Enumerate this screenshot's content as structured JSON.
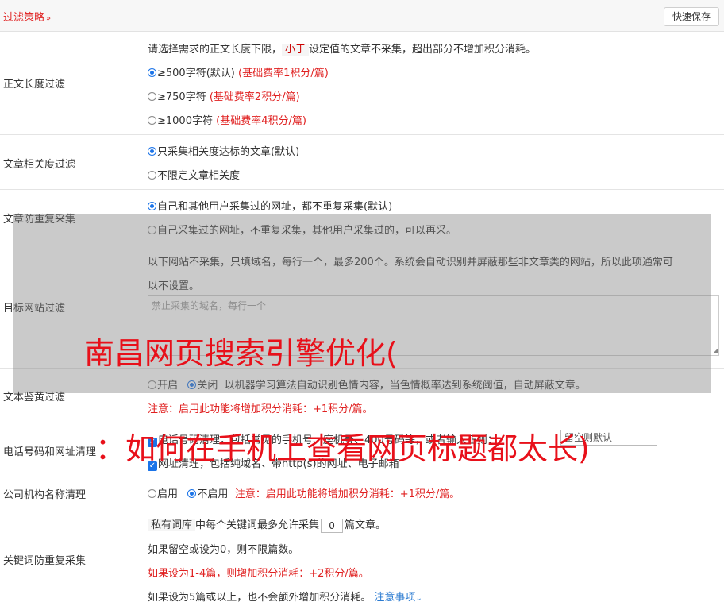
{
  "header": {
    "title": "过滤策略",
    "chevron": "»",
    "save_label": "快速保存"
  },
  "length_filter": {
    "label": "正文长度过滤",
    "desc_pre": "请选择需求的正文长度下限，",
    "desc_hl": "小于",
    "desc_post": "设定值的文章不采集，超出部分不增加积分消耗。",
    "options": [
      {
        "text": "≥500字符(默认)",
        "note": "(基础费率1积分/篇)",
        "selected": true
      },
      {
        "text": "≥750字符",
        "note": "(基础费率2积分/篇)",
        "selected": false
      },
      {
        "text": "≥1000字符",
        "note": "(基础费率4积分/篇)",
        "selected": false
      }
    ]
  },
  "relevance": {
    "label": "文章相关度过滤",
    "options": [
      {
        "text": "只采集相关度达标的文章(默认)",
        "selected": true
      },
      {
        "text": "不限定文章相关度",
        "selected": false
      }
    ]
  },
  "dedup": {
    "label": "文章防重复采集",
    "options": [
      {
        "text": "自己和其他用户采集过的网址，都不重复采集(默认)",
        "selected": true
      },
      {
        "text": "自己采集过的网址，不重复采集，其他用户采集过的，可以再采。",
        "selected": false
      }
    ]
  },
  "site_filter": {
    "label": "目标网站过滤",
    "desc1": "以下网站不采集，只填域名，每行一个，最多200个。系统会自动识别并屏蔽那些非文章类的网站，所以此项通常可",
    "desc2": "以不设置。",
    "placeholder": "禁止采集的域名，每行一个"
  },
  "porn_filter": {
    "label": "文本鉴黄过滤",
    "opt_on": "开启",
    "opt_off": "关闭",
    "desc": "以机器学习算法自动识别色情内容，当色情概率达到系统阈值，自动屏蔽文章。",
    "note": "注意：启用此功能将增加积分消耗：+1积分/篇。"
  },
  "phone_clean": {
    "label": "电话号码和网址清理",
    "line1": "电话号码清理，包括常见的手机号、座机号、400号码等，或者输入正则：",
    "regex_value": "留空则默认",
    "line2": "网址清理，包括纯域名、带http(s)的网址、电子邮箱"
  },
  "org_clean": {
    "label": "公司机构名称清理",
    "opt_on": "启用",
    "opt_off": "不启用",
    "note": "注意：启用此功能将增加积分消耗：+1积分/篇。"
  },
  "keyword_dedup": {
    "label": "关键词防重复采集",
    "hl": "私有词库",
    "line1_a": "中每个关键词最多允许采集",
    "value": "0",
    "line1_b": "篇文章。",
    "line2": "如果留空或设为0，则不限篇数。",
    "line3": "如果设为1-4篇，则增加积分消耗：+2积分/篇。",
    "line4": "如果设为5篇或以上，也不会额外增加积分消耗。",
    "link": "注意事项"
  },
  "watermark": {
    "line1": "南昌网页搜索引擎优化(",
    "line2": "：如何在手机上查看网页标题都太长)"
  },
  "colors": {
    "accent_red": "#e02020",
    "radio_blue": "#1a73e8",
    "link_blue": "#2b7bd1"
  }
}
